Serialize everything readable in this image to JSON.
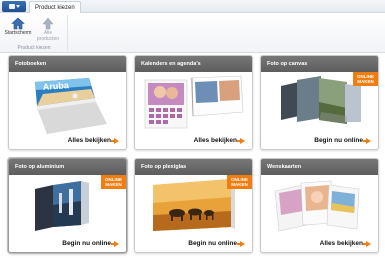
{
  "ribbon": {
    "tab_label": "Product kiezen",
    "home_label": "Startscherm",
    "all_products_label_line1": "Alle",
    "all_products_label_line2": "producten",
    "group_label": "Product kiezen"
  },
  "colors": {
    "accent": "#ef7d10",
    "tile_header": "#666666"
  },
  "tiles": [
    {
      "title": "Fotoboeken",
      "link": "Alles bekijken",
      "badge_line1": "",
      "badge_line2": "",
      "book_cover_text": "Aruba"
    },
    {
      "title": "Kalenders en agenda's",
      "link": "Alles bekijken",
      "badge_line1": "",
      "badge_line2": ""
    },
    {
      "title": "Foto op canvas",
      "link": "Begin nu online",
      "badge_line1": "ONLINE",
      "badge_line2": "MAKEN"
    },
    {
      "title": "Foto op aluminium",
      "link": "Begin nu online",
      "badge_line1": "ONLINE",
      "badge_line2": "MAKEN"
    },
    {
      "title": "Foto op plexiglas",
      "link": "Begin nu online",
      "badge_line1": "ONLINE",
      "badge_line2": "MAKEN"
    },
    {
      "title": "Wenskaarten",
      "link": "Alles bekijken",
      "badge_line1": "",
      "badge_line2": ""
    }
  ]
}
